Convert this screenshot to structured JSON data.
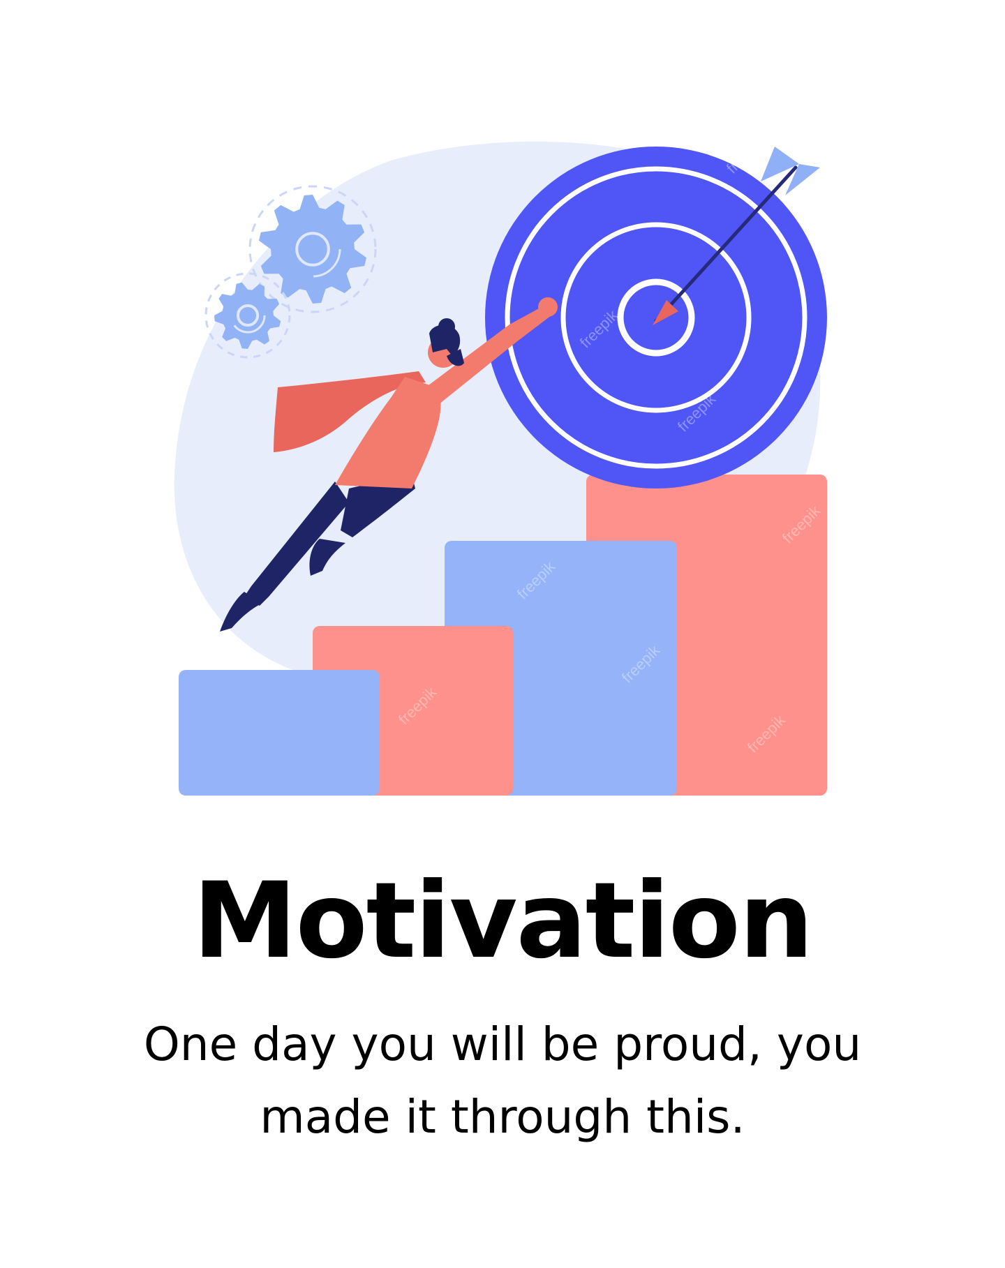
{
  "colors": {
    "background": "#ffffff",
    "blob": "#e8edfb",
    "target": "#5056f5",
    "target_ring": "#ffffff",
    "bar_blue": "#94b3f8",
    "bar_salmon": "#ff918c",
    "gear": "#91b3f5",
    "cape": "#e8665c",
    "shirt": "#f37b6e",
    "pants": "#1f2466",
    "hair": "#1f2466",
    "arrow_shaft": "#252a7a",
    "arrow_fletch": "#8fb0f7",
    "arrow_tip": "#e8665c"
  },
  "icons": [
    "gear-icon",
    "target-icon",
    "arrow-icon",
    "superhero-figure",
    "bar-steps"
  ],
  "watermark": "freepik",
  "content": {
    "title": "Motivation",
    "subtitle": "One day you will be proud, you made it through this."
  }
}
